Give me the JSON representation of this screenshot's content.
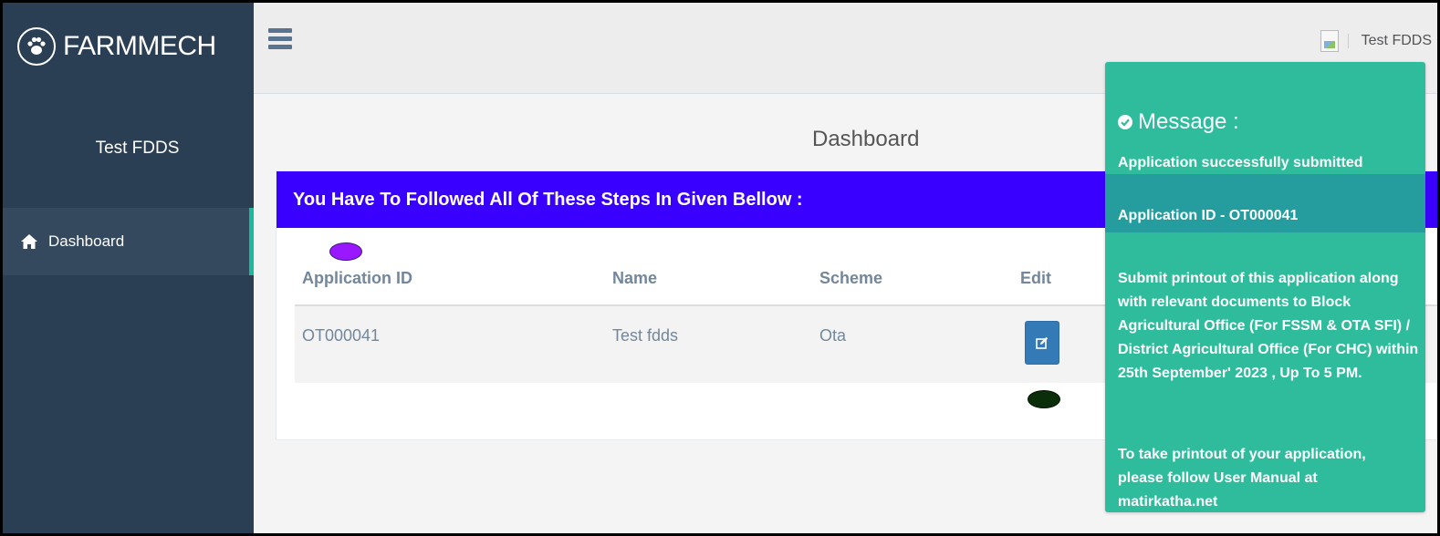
{
  "app": {
    "brand": "FARMMECH"
  },
  "sidebar": {
    "profile_name": "Test FDDS",
    "items": [
      {
        "label": "Dashboard",
        "icon": "home-icon",
        "active": true
      }
    ]
  },
  "topbar": {
    "user_name": "Test FDDS",
    "menu_icon": "hamburger-icon"
  },
  "main": {
    "page_title": "Dashboard",
    "panel_heading": "You Have To Followed All Of These Steps In Given Bellow :",
    "table": {
      "headers": [
        "Application ID",
        "Name",
        "Scheme",
        "Edit"
      ],
      "rows": [
        {
          "application_id": "OT000041",
          "name": "Test fdds",
          "scheme": "Ota",
          "edit_icon": "edit-icon"
        }
      ]
    }
  },
  "notification": {
    "title": "Message :",
    "line1": "Application successfully submitted",
    "app_id_line": "Application ID - OT000041",
    "submit_text": "Submit printout of this application along with relevant documents to Block Agricultural Office (For FSSM & OTA SFI) / District Agricultural Office (For CHC) within 25th September' 2023 , Up To 5 PM.",
    "printout_text": "To take printout of your application, please follow User Manual at matirkatha.net"
  },
  "colors": {
    "sidebar_bg": "#2a3f54",
    "panel_heading_bg": "#3a00ff",
    "notification_bg": "#2ebc9c",
    "edit_button_bg": "#337ab7",
    "active_accent": "#1abb9c"
  }
}
